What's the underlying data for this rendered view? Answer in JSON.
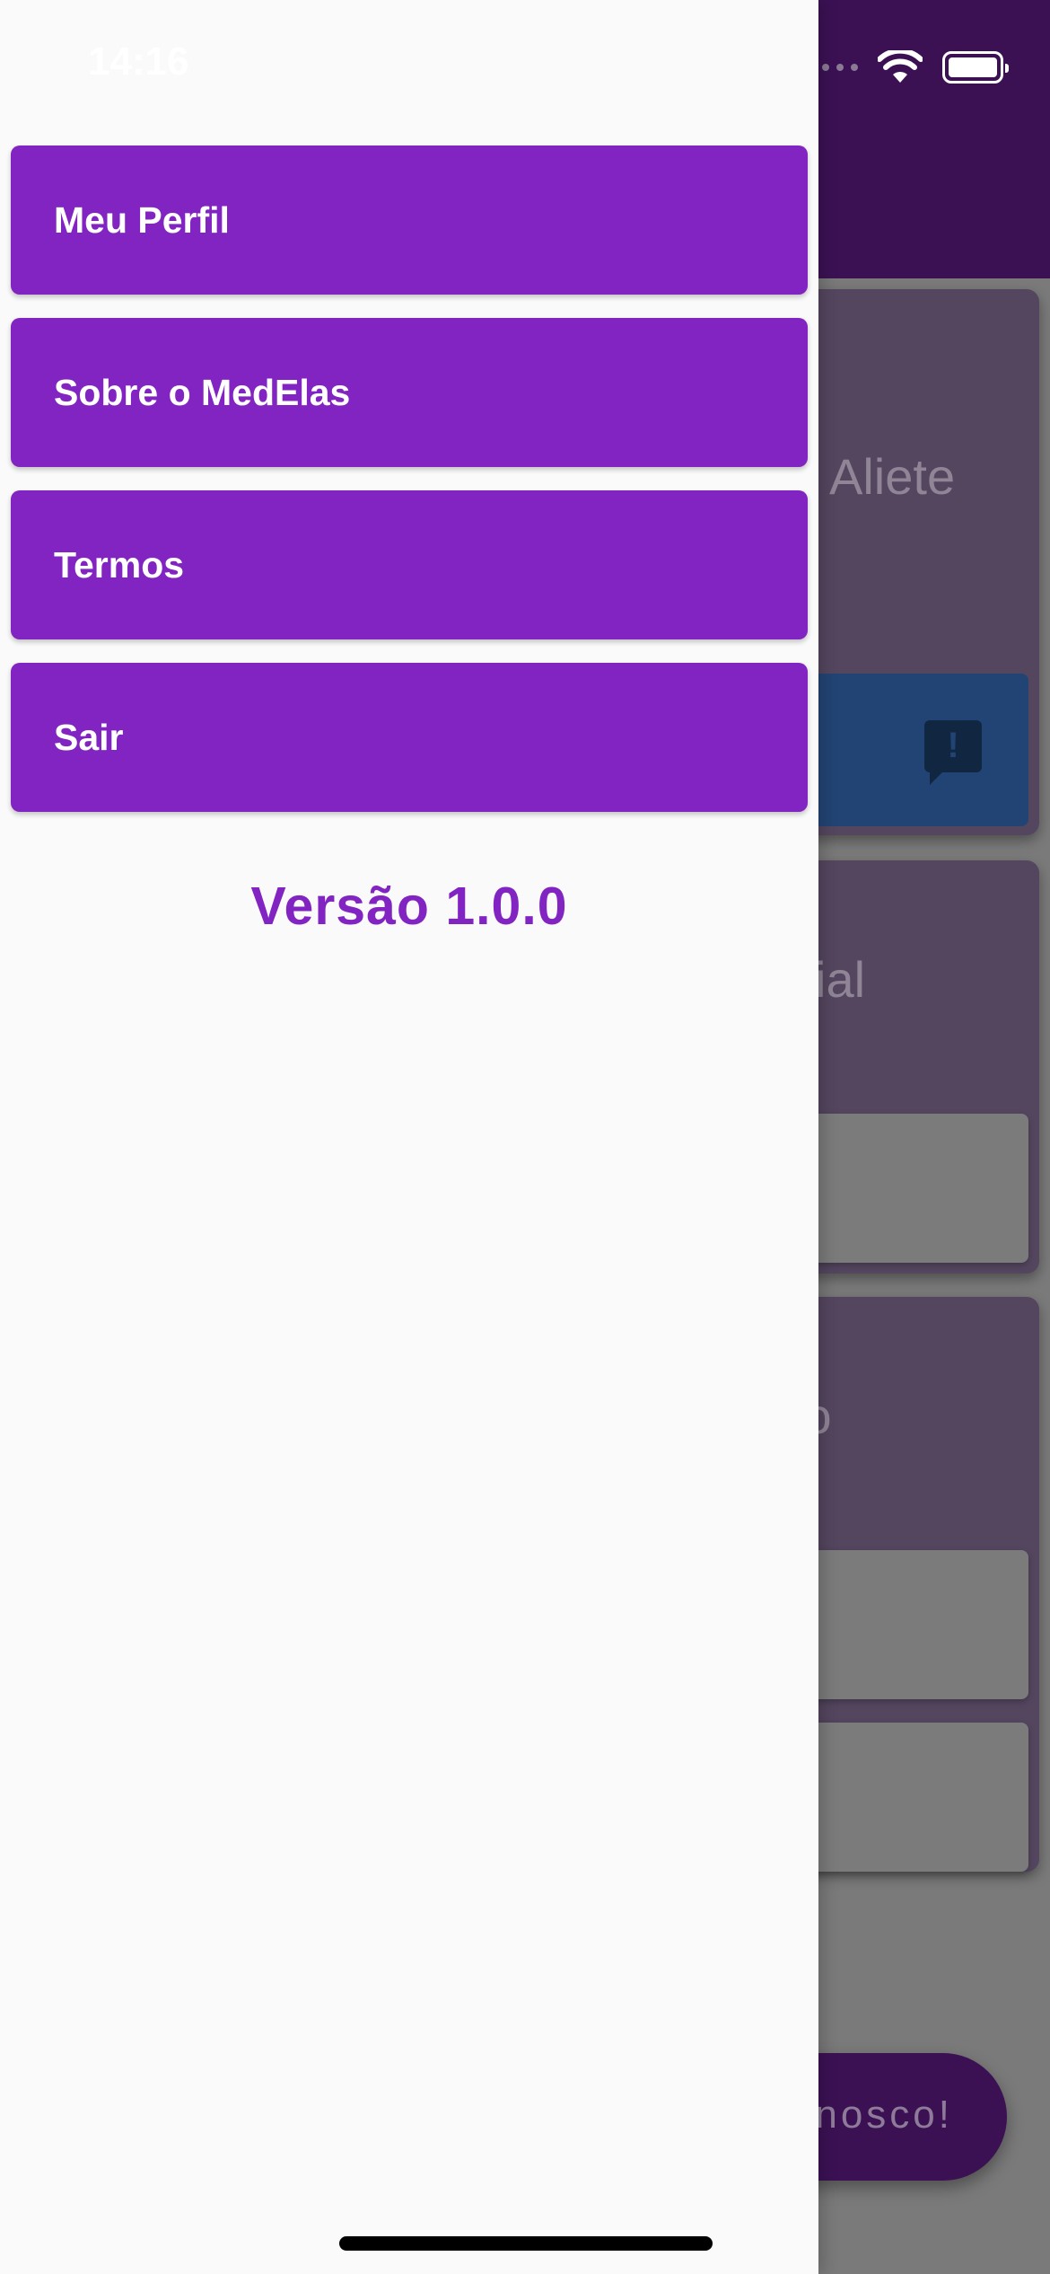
{
  "status_bar": {
    "time": "14:16"
  },
  "drawer": {
    "menu_items": [
      {
        "label": "Meu Perfil"
      },
      {
        "label": "Sobre o MedElas"
      },
      {
        "label": "Termos"
      },
      {
        "label": "Sair"
      }
    ],
    "version_text": "Versão 1.0.0"
  },
  "background": {
    "card_1_text": "Aliete",
    "card_2_text": "cial",
    "card_3_text": "to",
    "fab_label": "nosco!",
    "alert_icon_mark": "!"
  },
  "colors": {
    "drawer_bg": "#fafafa",
    "menu_button": "#8224c2",
    "version_text": "#8224c2",
    "app_bar": "#3b1154"
  },
  "icons": [
    "wifi-icon",
    "battery-icon",
    "feedback-alert-icon"
  ]
}
